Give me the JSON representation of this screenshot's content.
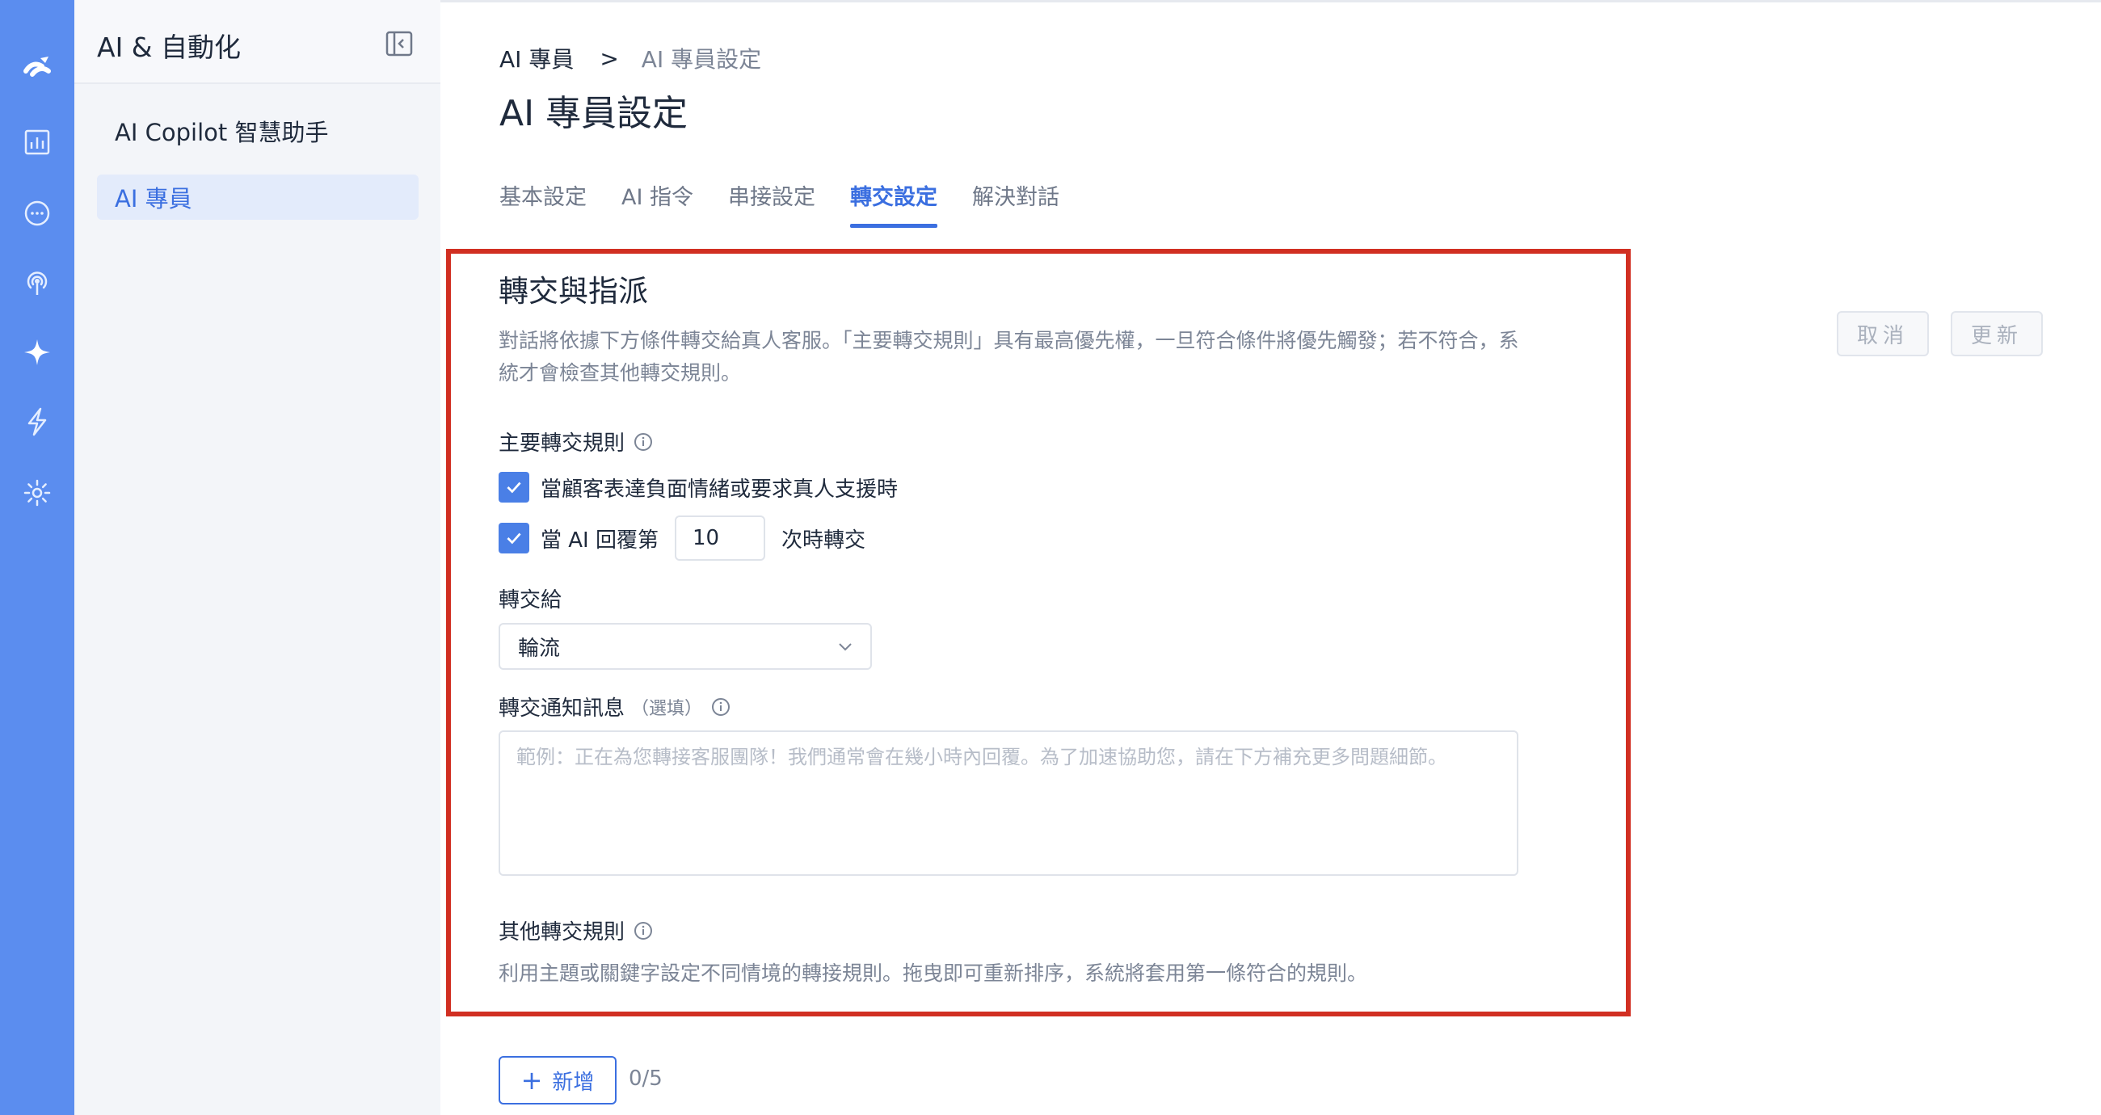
{
  "colors": {
    "accent": "#3b6fe0",
    "rail": "#5b8def",
    "highlight": "#d12f22"
  },
  "rail": {
    "icons": [
      "logo-icon",
      "analytics-icon",
      "chat-icon",
      "broadcast-icon",
      "ai-sparkle-icon",
      "automation-bolt-icon",
      "settings-gear-icon"
    ]
  },
  "sidebar": {
    "title": "AI & 自動化",
    "items": [
      {
        "label": "AI Copilot 智慧助手",
        "active": false
      },
      {
        "label": "AI 專員",
        "active": true
      }
    ]
  },
  "header": {
    "breadcrumb": {
      "parent": "AI 專員",
      "separator": ">",
      "current": "AI 專員設定"
    },
    "title": "AI 專員設定",
    "tabs": [
      {
        "label": "基本設定",
        "active": false
      },
      {
        "label": "AI 指令",
        "active": false
      },
      {
        "label": "串接設定",
        "active": false
      },
      {
        "label": "轉交設定",
        "active": true
      },
      {
        "label": "解決對話",
        "active": false
      }
    ],
    "cancel_label": "取消",
    "update_label": "更新"
  },
  "section": {
    "title": "轉交與指派",
    "description": "對話將依據下方條件轉交給真人客服。「主要轉交規則」具有最高優先權，一旦符合條件將優先觸發；若不符合，系統才會檢查其他轉交規則。",
    "primary_rules_label": "主要轉交規則",
    "rule1_label": "當顧客表達負面情緒或要求真人支援時",
    "rule1_checked": true,
    "rule2_prefix": "當 AI 回覆第",
    "rule2_value": "10",
    "rule2_suffix": "次時轉交",
    "rule2_checked": true,
    "transfer_to_label": "轉交給",
    "transfer_to_value": "輪流",
    "notice_label": "轉交通知訊息",
    "notice_optional": "（選填）",
    "notice_placeholder": "範例：正在為您轉接客服團隊！我們通常會在幾小時內回覆。為了加速協助您，請在下方補充更多問題細節。",
    "other_rules_label": "其他轉交規則",
    "other_rules_desc": "利用主題或關鍵字設定不同情境的轉接規則。拖曳即可重新排序，系統將套用第一條符合的規則。"
  },
  "footer": {
    "add_label": "新增",
    "counter": "0/5"
  }
}
